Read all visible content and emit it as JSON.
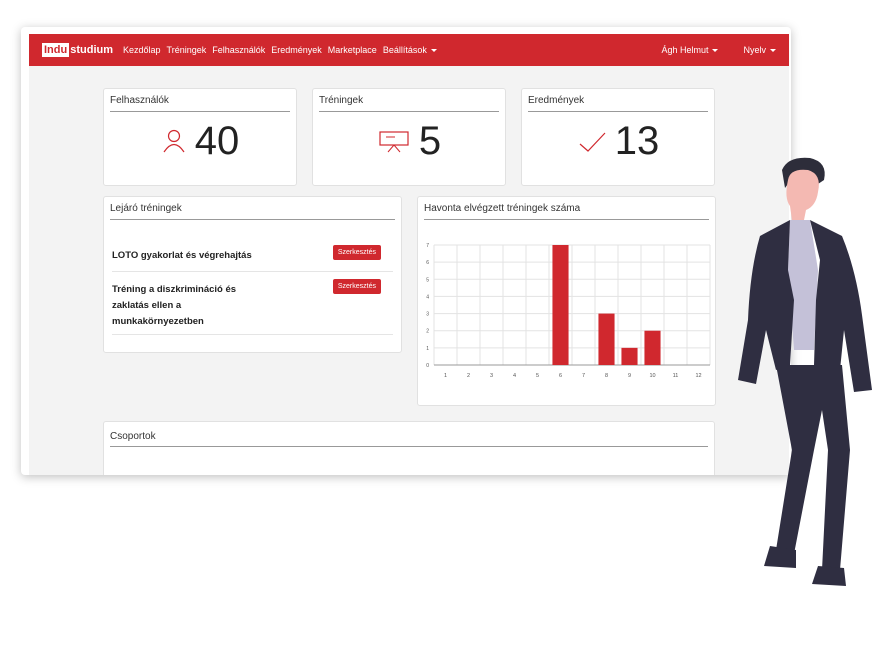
{
  "navbar": {
    "brand_box": "Indu",
    "brand_rest": "studium",
    "items": [
      "Kezdőlap",
      "Tréningek",
      "Felhasználók",
      "Eredmények",
      "Marketplace",
      "Beállítások"
    ],
    "user": "Ágh Helmut",
    "language": "Nyelv"
  },
  "stats": {
    "users": {
      "title": "Felhasználók",
      "value": "40",
      "icon": "user-icon"
    },
    "trainings": {
      "title": "Tréningek",
      "value": "5",
      "icon": "presentation-icon"
    },
    "results": {
      "title": "Eredmények",
      "value": "13",
      "icon": "checkmark-icon"
    }
  },
  "expiring": {
    "title": "Lejáró tréningek",
    "rows": [
      {
        "name": "LOTO gyakorlat és végrehajtás",
        "button": "Szerkesztés"
      },
      {
        "name": "Tréning a diszkrimináció és zaklatás ellen a munkakörnyezetben",
        "button": "Szerkesztés"
      }
    ]
  },
  "groups": {
    "title": "Csoportok"
  },
  "colors": {
    "brand": "#d0282e"
  },
  "chart_data": {
    "type": "bar",
    "title": "Havonta elvégzett tréningek száma",
    "categories": [
      "1",
      "2",
      "3",
      "4",
      "5",
      "6",
      "7",
      "8",
      "9",
      "10",
      "11",
      "12"
    ],
    "values": [
      0,
      0,
      0,
      0,
      0,
      7,
      0,
      3,
      1,
      2,
      0,
      0
    ],
    "ylim": [
      0,
      7
    ],
    "yticks": [
      "0",
      "1",
      "2",
      "3",
      "4",
      "5",
      "6",
      "7"
    ],
    "grid": true,
    "color": "#d0282e"
  }
}
